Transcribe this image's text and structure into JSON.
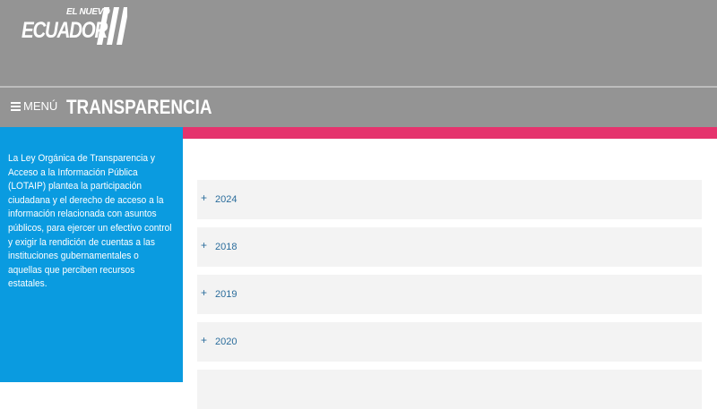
{
  "header": {
    "logo_small": "EL NUEVO",
    "logo_main": "ECUADOR"
  },
  "nav": {
    "menu_label": "MENÚ",
    "title": "TRANSPARENCIA"
  },
  "sidebar": {
    "text": "La Ley Orgánica de Transparencia y Acceso a la Información Pública (LOTAIP) plantea la participación ciudadana y el derecho de acceso a la información relacionada con asuntos públicos, para ejercer un efectivo control y exigir la rendición de cuentas a las instituciones gubernamentales o aquellas que perciben recursos estatales."
  },
  "accordion": {
    "items": [
      {
        "icon": "+",
        "label": "2024"
      },
      {
        "icon": "+",
        "label": "2018"
      },
      {
        "icon": "+",
        "label": "2019"
      },
      {
        "icon": "+",
        "label": "2020"
      },
      {
        "icon": "",
        "label": ""
      }
    ]
  },
  "colors": {
    "header_gray": "#949494",
    "sidebar_blue": "#0a9be0",
    "accent_pink": "#e5336d",
    "link_blue": "#2b6d9c"
  }
}
